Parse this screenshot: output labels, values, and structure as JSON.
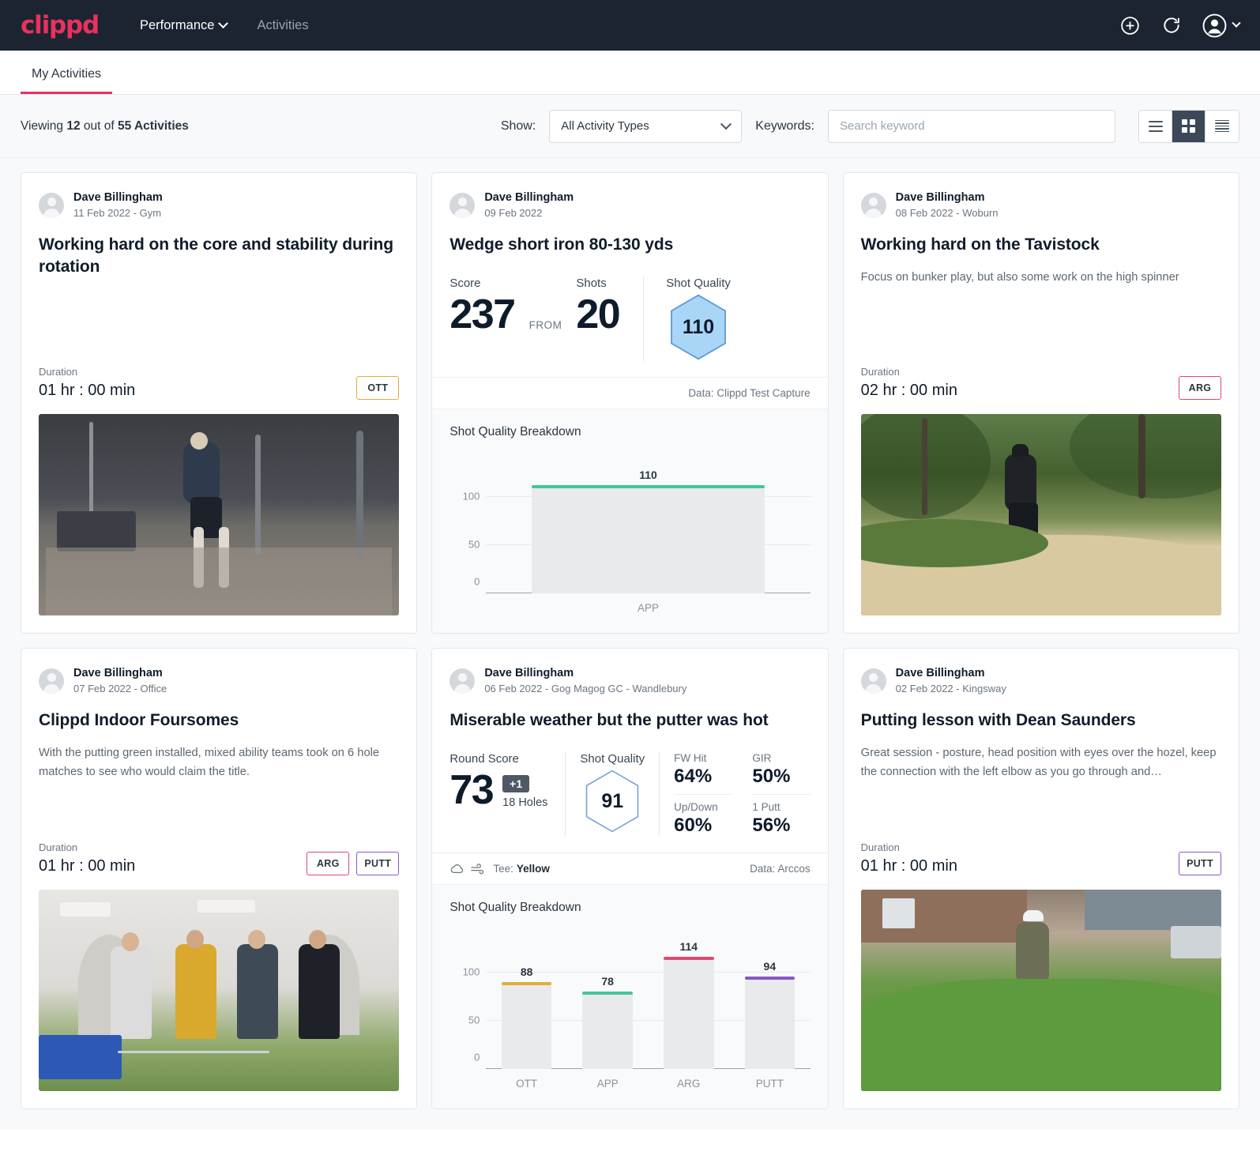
{
  "header": {
    "logo": "clippd",
    "nav": [
      {
        "label": "Performance",
        "has_chevron": true,
        "active": true
      },
      {
        "label": "Activities",
        "has_chevron": false,
        "active": false
      }
    ],
    "icons": [
      "plus-circle-icon",
      "refresh-icon",
      "account-avatar-icon",
      "chevron-down-icon"
    ]
  },
  "tabs": [
    {
      "label": "My Activities",
      "active": true
    }
  ],
  "filters": {
    "viewing_prefix": "Viewing",
    "viewing_count": "12",
    "viewing_middle": "out of",
    "viewing_total": "55 Activities",
    "show_label": "Show:",
    "show_value": "All Activity Types",
    "keywords_label": "Keywords:",
    "search_value": "",
    "search_placeholder": "Search keyword",
    "view_modes": [
      {
        "name": "list-view",
        "active": false
      },
      {
        "name": "grid-view",
        "active": true
      },
      {
        "name": "compact-view",
        "active": false
      }
    ]
  },
  "colors": {
    "brand": "#e8315f",
    "nav_bg": "#1b2430",
    "page_bg": "#f7f9fb",
    "ott": "#e0ae3a",
    "app": "#43c59e",
    "arg": "#e0486f",
    "putt": "#8a56c4",
    "hex_fill": "#a9d5f7",
    "hex_stroke": "#5b9bd5"
  },
  "cards": [
    {
      "author": "Dave Billingham",
      "meta": "11 Feb 2022 - Gym",
      "title": "Working hard on the core and stability during rotation",
      "description": "",
      "duration_label": "Duration",
      "duration_value": "01 hr : 00 min",
      "tags": [
        "OTT"
      ],
      "photo": "gym"
    },
    {
      "author": "Dave Billingham",
      "meta": "09 Feb 2022",
      "title": "Wedge short iron 80-130 yds",
      "stats": {
        "score_label": "Score",
        "score_value": "237",
        "from_label": "FROM",
        "shots_label": "Shots",
        "shots_value": "20",
        "quality_label": "Shot Quality",
        "quality_value": "110"
      },
      "data_source": "Data: Clippd Test Capture",
      "chart_title": "Shot Quality Breakdown"
    },
    {
      "author": "Dave Billingham",
      "meta": "08 Feb 2022 - Woburn",
      "title": "Working hard on the Tavistock",
      "description": "Focus on bunker play, but also some work on the high spinner",
      "duration_label": "Duration",
      "duration_value": "02 hr : 00 min",
      "tags": [
        "ARG"
      ],
      "photo": "bunker"
    },
    {
      "author": "Dave Billingham",
      "meta": "07 Feb 2022 - Office",
      "title": "Clippd Indoor Foursomes",
      "description": "With the putting green installed, mixed ability teams took on 6 hole matches to see who would claim the title.",
      "duration_label": "Duration",
      "duration_value": "01 hr : 00 min",
      "tags": [
        "ARG",
        "PUTT"
      ],
      "photo": "indoor"
    },
    {
      "author": "Dave Billingham",
      "meta": "06 Feb 2022 - Gog Magog GC - Wandlebury",
      "title": "Miserable weather but the putter was hot",
      "stats": {
        "round_label": "Round Score",
        "round_value": "73",
        "over_badge": "+1",
        "holes": "18 Holes",
        "quality_label": "Shot Quality",
        "quality_value": "91",
        "kpis": [
          {
            "label": "FW Hit",
            "value": "64%"
          },
          {
            "label": "GIR",
            "value": "50%"
          },
          {
            "label": "Up/Down",
            "value": "60%"
          },
          {
            "label": "1 Putt",
            "value": "56%"
          }
        ]
      },
      "tee_label": "Tee:",
      "tee_value": "Yellow",
      "data_source": "Data: Arccos",
      "chart_title": "Shot Quality Breakdown"
    },
    {
      "author": "Dave Billingham",
      "meta": "02 Feb 2022 - Kingsway",
      "title": "Putting lesson with Dean Saunders",
      "description": "Great session - posture, head position with eyes over the hozel, keep the connection with the left elbow as you go through and…",
      "duration_label": "Duration",
      "duration_value": "01 hr : 00 min",
      "tags": [
        "PUTT"
      ],
      "photo": "green"
    }
  ],
  "chart_data": [
    {
      "type": "bar",
      "title": "Shot Quality Breakdown",
      "categories": [
        "APP"
      ],
      "values": [
        110
      ],
      "cap_colors": [
        "#43c59e"
      ],
      "yticks": [
        0,
        50,
        100
      ],
      "ylim": [
        0,
        130
      ],
      "xlabel": "",
      "ylabel": "",
      "grid": true
    },
    {
      "type": "bar",
      "title": "Shot Quality Breakdown",
      "categories": [
        "OTT",
        "APP",
        "ARG",
        "PUTT"
      ],
      "values": [
        88,
        78,
        114,
        94
      ],
      "cap_colors": [
        "#e0ae3a",
        "#43c59e",
        "#e0486f",
        "#8a56c4"
      ],
      "yticks": [
        0,
        50,
        100
      ],
      "ylim": [
        0,
        130
      ],
      "xlabel": "",
      "ylabel": "",
      "grid": true
    }
  ]
}
